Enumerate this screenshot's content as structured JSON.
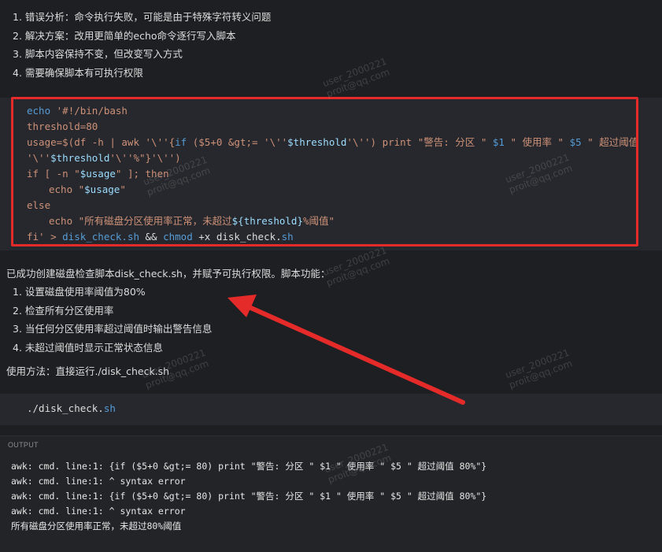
{
  "top_list": [
    "1. 错误分析：命令执行失败，可能是由于特殊字符转义问题",
    "2. 解决方案：改用更简单的echo命令逐行写入脚本",
    "3. 脚本内容保持不变，但改变写入方式",
    "4. 需要确保脚本有可执行权限"
  ],
  "code_block": {
    "lines": [
      [
        "echo ",
        "'#!/bin/bash"
      ],
      [
        "threshold=80"
      ],
      [
        "usage=$(df -h | awk '\\''{",
        "if",
        " ($5+0 &gt;= '\\''",
        "$threshold",
        "'\\'') print \"警告: 分区 \" ",
        "$1",
        " \" 使用率 \" ",
        "$5",
        " \" 超过阈值"
      ],
      [
        "'\\''",
        "$threshold",
        "'\\''%\"}'\\'')"
      ],
      [
        "if [ -n \"",
        "$usage",
        "\" ]; then"
      ],
      [
        "echo \"",
        "$usage",
        "\""
      ],
      [
        "else"
      ],
      [
        "echo \"所有磁盘分区使用率正常，未超过",
        "${threshold}",
        "%阈值\""
      ],
      [
        "fi' > ",
        "disk_check.sh",
        " && ",
        "chmod",
        " +x ",
        "disk_check",
        ".",
        "sh"
      ]
    ]
  },
  "summary": "已成功创建磁盘检查脚本disk_check.sh，并赋予可执行权限。脚本功能：",
  "feature_list": [
    "1. 设置磁盘使用率阈值为80%",
    "2. 检查所有分区使用率",
    "3. 当任何分区使用率超过阈值时输出警告信息",
    "4. 未超过阈值时显示正常状态信息"
  ],
  "usage_text": "使用方法：直接运行./disk_check.sh",
  "run_command": {
    "prefix": "./disk_check.",
    "ext": "sh"
  },
  "output": {
    "label": "OUTPUT",
    "lines": [
      "awk: cmd. line:1: {if ($5+0 &gt;= 80) print \"警告: 分区 \" $1 \" 使用率 \" $5 \" 超过阈值 80%\"}",
      "awk: cmd. line:1: ^ syntax error",
      "awk: cmd. line:1: {if ($5+0 &gt;= 80) print \"警告: 分区 \" $1 \" 使用率 \" $5 \" 超过阈值 80%\"}",
      "awk: cmd. line:1: ^ syntax error",
      "所有磁盘分区使用率正常，未超过80%阈值"
    ]
  },
  "watermark": {
    "user": "user_2000221",
    "email": "proit@qq.com"
  },
  "colors": {
    "highlight_box": "#e52a2a",
    "arrow": "#e52a2a",
    "keyword": "#569cd6",
    "string": "#ce9178",
    "variable": "#9cdcfe"
  }
}
